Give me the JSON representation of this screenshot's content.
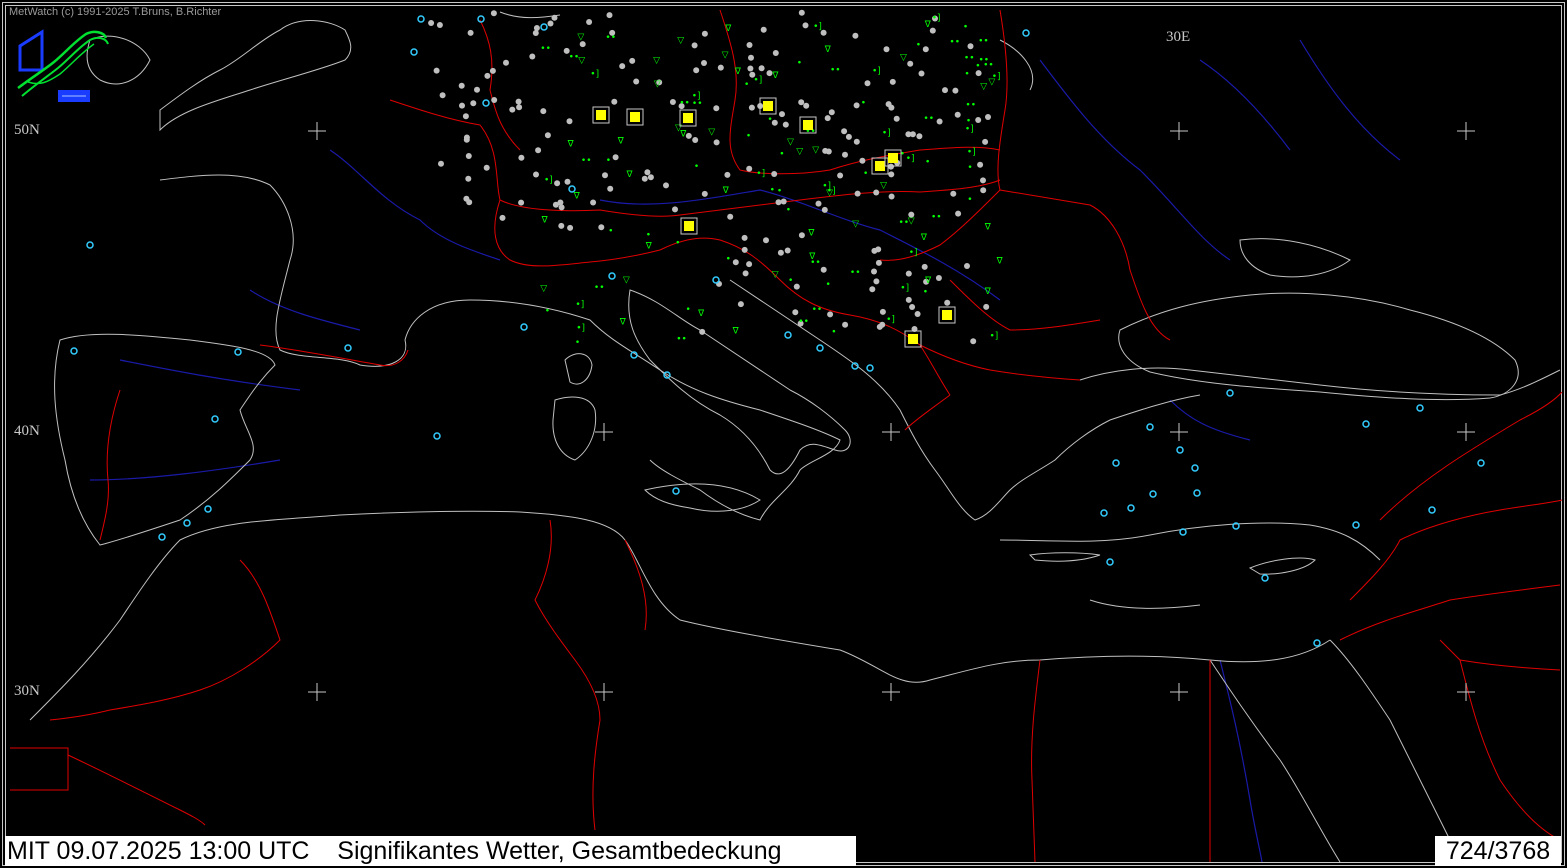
{
  "app": {
    "copyright": "MetWatch  (c) 1991-2025 T.Bruns, B.Richter"
  },
  "map": {
    "lat_labels": [
      "50N",
      "40N",
      "30N"
    ],
    "lon_labels": [
      "30E"
    ],
    "colors": {
      "background": "#000000",
      "coast": "#c0c0c0",
      "border": "#e00000",
      "river": "#1a1aa8",
      "clear_station": "#33ccff",
      "cloudy_station": "#bfbfbf",
      "weather_symbol": "#00ff00",
      "fog_symbol": "#ffff00"
    }
  },
  "status": {
    "datetime": "MIT 09.07.2025 13:00 UTC",
    "product": "Signifikantes Wetter, Gesamtbedeckung",
    "count": "724/3768"
  }
}
